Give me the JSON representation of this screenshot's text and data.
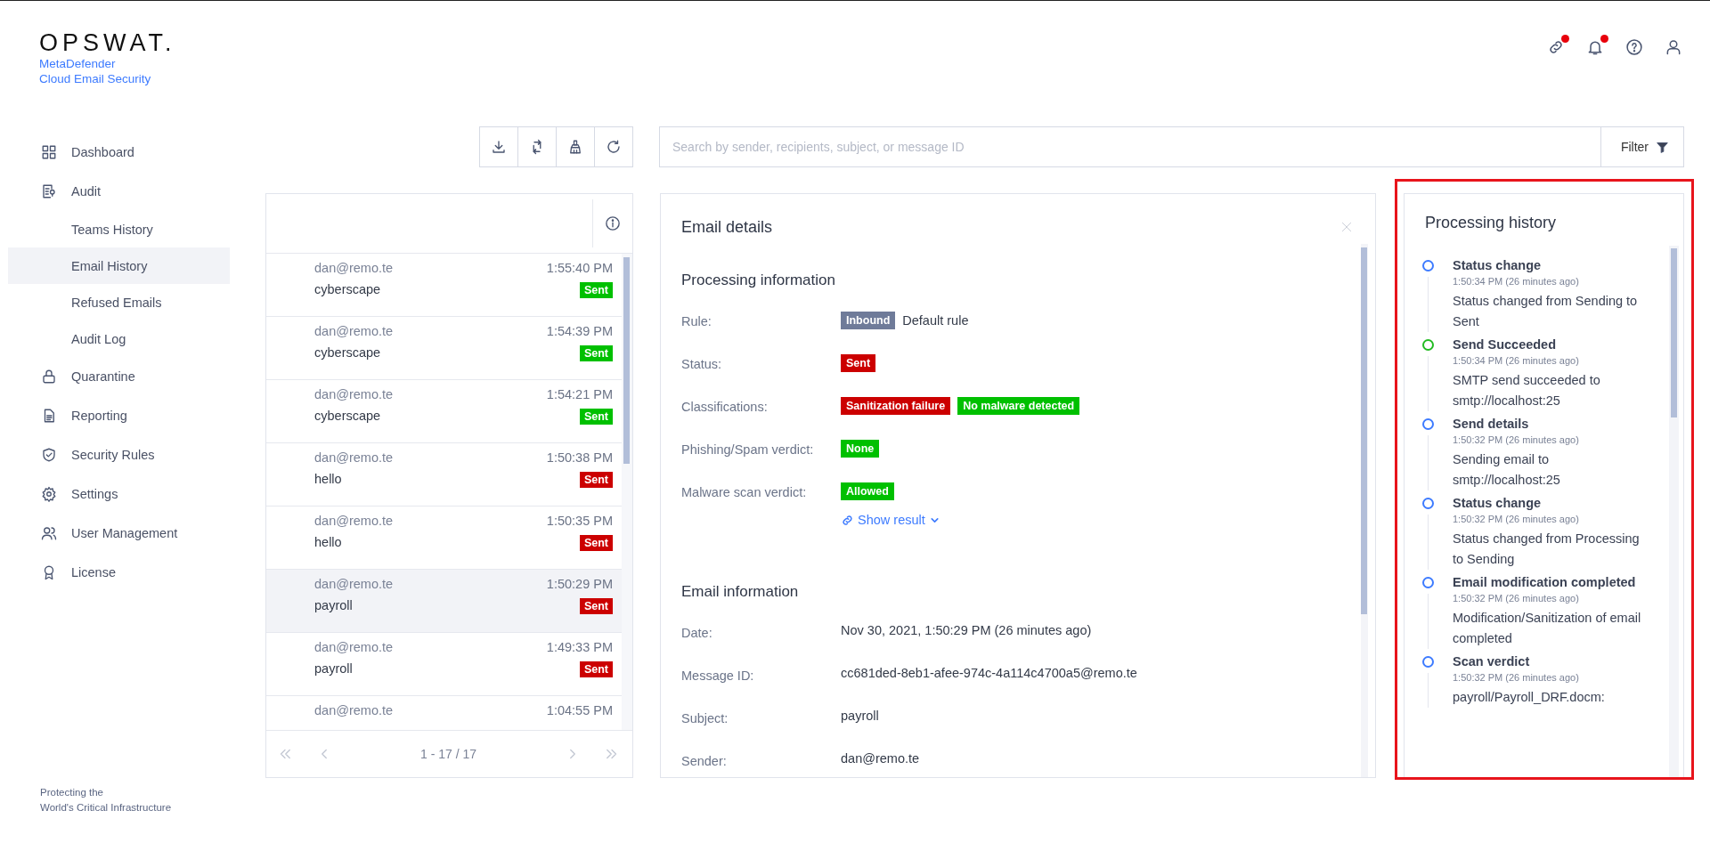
{
  "sidebar": {
    "logo": {
      "wordmark": "OPSWAT.",
      "product_lines": [
        "MetaDefender",
        "Cloud Email Security"
      ]
    },
    "items": [
      {
        "label": "Dashboard",
        "selected": false
      },
      {
        "label": "Audit",
        "selected": false,
        "children": [
          {
            "label": "Teams History",
            "selected": false
          },
          {
            "label": "Email History",
            "selected": true
          },
          {
            "label": "Refused Emails",
            "selected": false
          },
          {
            "label": "Audit Log",
            "selected": false
          }
        ]
      },
      {
        "label": "Quarantine",
        "selected": false
      },
      {
        "label": "Reporting",
        "selected": false
      },
      {
        "label": "Security Rules",
        "selected": false
      },
      {
        "label": "Settings",
        "selected": false
      },
      {
        "label": "User Management",
        "selected": false
      },
      {
        "label": "License",
        "selected": false
      }
    ],
    "tagline": [
      "Protecting the",
      "World's Critical Infrastructure"
    ]
  },
  "header_icons": [
    {
      "notification": true
    },
    {
      "notification": true
    },
    {
      "notification": false
    },
    {
      "notification": false
    }
  ],
  "search": {
    "placeholder": "Search by sender, recipients, subject, or message ID",
    "filter_button": "Filter"
  },
  "email_list": {
    "rows": [
      {
        "sender": "dan@remo.te",
        "time": "1:55:40 PM",
        "subject": "cyberscape",
        "status": {
          "text": "Sent",
          "color": "#00c000"
        },
        "selected": false
      },
      {
        "sender": "dan@remo.te",
        "time": "1:54:39 PM",
        "subject": "cyberscape",
        "status": {
          "text": "Sent",
          "color": "#00c000"
        },
        "selected": false
      },
      {
        "sender": "dan@remo.te",
        "time": "1:54:21 PM",
        "subject": "cyberscape",
        "status": {
          "text": "Sent",
          "color": "#00c000"
        },
        "selected": false
      },
      {
        "sender": "dan@remo.te",
        "time": "1:50:38 PM",
        "subject": "hello",
        "status": {
          "text": "Sent",
          "color": "#cc0000"
        },
        "selected": false
      },
      {
        "sender": "dan@remo.te",
        "time": "1:50:35 PM",
        "subject": "hello",
        "status": {
          "text": "Sent",
          "color": "#cc0000"
        },
        "selected": false
      },
      {
        "sender": "dan@remo.te",
        "time": "1:50:29 PM",
        "subject": "payroll",
        "status": {
          "text": "Sent",
          "color": "#cc0000"
        },
        "selected": true
      },
      {
        "sender": "dan@remo.te",
        "time": "1:49:33 PM",
        "subject": "payroll",
        "status": {
          "text": "Sent",
          "color": "#cc0000"
        },
        "selected": false
      },
      {
        "sender": "dan@remo.te",
        "time": "1:04:55 PM",
        "selected": false
      }
    ],
    "pagination": "1 - 17 / 17"
  },
  "email_details": {
    "title": "Email details",
    "sections": [
      {
        "title": "Processing information",
        "fields": [
          {
            "label": "Rule:",
            "tags": [
              {
                "text": "Inbound",
                "color": "#6f7b99"
              }
            ],
            "value": "Default rule"
          },
          {
            "label": "Status:",
            "tags": [
              {
                "text": "Sent",
                "color": "#cc0000"
              }
            ]
          },
          {
            "label": "Classifications:",
            "tags": [
              {
                "text": "Sanitization failure",
                "color": "#cc0000"
              },
              {
                "text": "No malware detected",
                "color": "#00c000"
              }
            ]
          },
          {
            "label": "Phishing/Spam verdict:",
            "tags": [
              {
                "text": "None",
                "color": "#00c000"
              }
            ]
          },
          {
            "label": "Malware scan verdict:",
            "tags": [
              {
                "text": "Allowed",
                "color": "#00c000"
              }
            ],
            "link": "Show result"
          }
        ]
      },
      {
        "title": "Email information",
        "fields": [
          {
            "label": "Date:",
            "value": "Nov 30, 2021, 1:50:29 PM (26 minutes ago)"
          },
          {
            "label": "Message ID:",
            "value": "cc681ded-8eb1-afee-974c-4a114c4700a5@remo.te"
          },
          {
            "label": "Subject:",
            "value": "payroll"
          },
          {
            "label": "Sender:",
            "value": "dan@remo.te"
          }
        ]
      }
    ]
  },
  "processing_history": {
    "title": "Processing history",
    "highlighted": true,
    "events": [
      {
        "title": "Status change",
        "time": "1:50:34 PM (26 minutes ago)",
        "description": "Status changed from Sending to Sent",
        "color": "#3d7bff"
      },
      {
        "title": "Send Succeeded",
        "time": "1:50:34 PM (26 minutes ago)",
        "description": "SMTP send succeeded to smtp://localhost:25",
        "color": "#22bb22"
      },
      {
        "title": "Send details",
        "time": "1:50:32 PM (26 minutes ago)",
        "description": "Sending email to smtp://localhost:25",
        "color": "#3d7bff"
      },
      {
        "title": "Status change",
        "time": "1:50:32 PM (26 minutes ago)",
        "description": "Status changed from Processing to Sending",
        "color": "#3d7bff"
      },
      {
        "title": "Email modification completed",
        "time": "1:50:32 PM (26 minutes ago)",
        "description": "Modification/Sanitization of email completed",
        "color": "#3d7bff"
      },
      {
        "title": "Scan verdict",
        "time": "1:50:32 PM (26 minutes ago)",
        "description": "payroll/Payroll_DRF.docm:",
        "color": "#3d7bff"
      }
    ]
  }
}
